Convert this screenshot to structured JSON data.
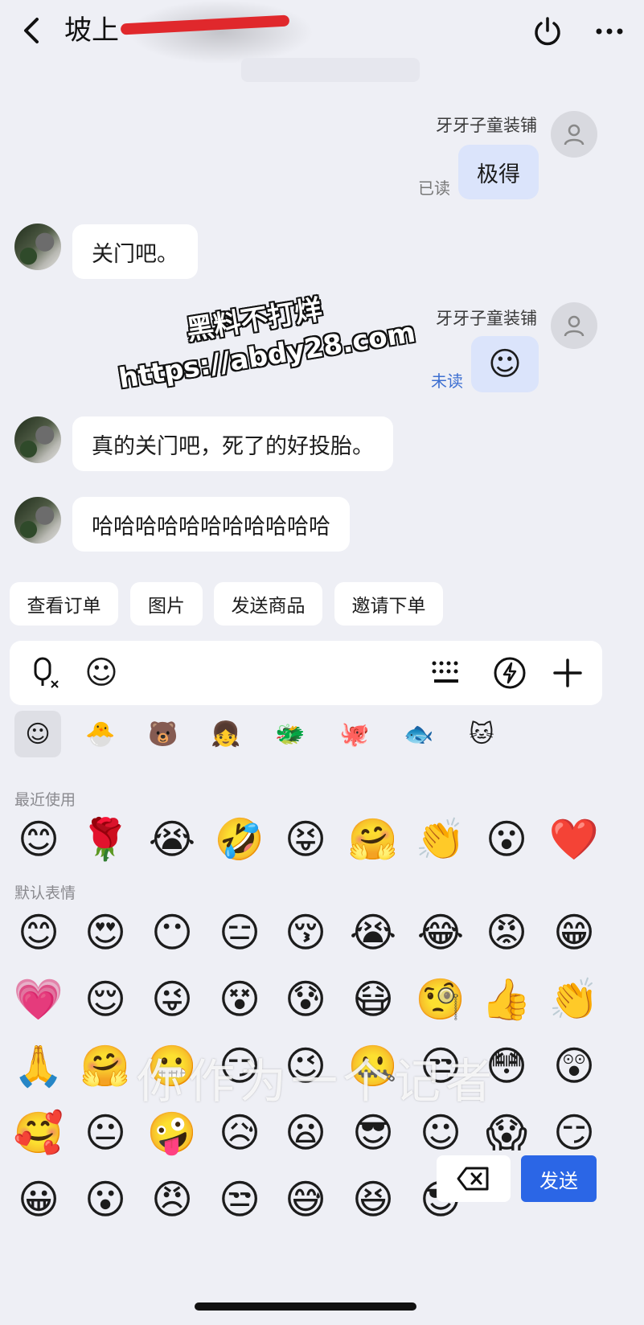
{
  "header": {
    "title": "坡上",
    "back_icon": "chevron-left-icon",
    "power_icon": "power-icon",
    "more_icon": "more-horizontal-icon"
  },
  "messages": [
    {
      "side": "right",
      "sender": "牙牙子童装铺",
      "text": "极得",
      "status": "已读"
    },
    {
      "side": "left",
      "text": "关门吧。"
    },
    {
      "side": "right",
      "sender": "牙牙子童装铺",
      "emoji": "☺",
      "status": "未读"
    },
    {
      "side": "left",
      "text": "真的关门吧，死了的好投胎。"
    },
    {
      "side": "left",
      "text": "哈哈哈哈哈哈哈哈哈哈哈"
    }
  ],
  "watermark": {
    "line1": "黑料不打烊",
    "line2": "https://abdy28.com",
    "subtitle": "你作为一个记者"
  },
  "quick_replies": [
    "查看订单",
    "图片",
    "发送商品",
    "邀请下单"
  ],
  "input_bar": {
    "voice_icon": "microphone-icon",
    "emoji_icon": "emoji-icon",
    "keyboard_icon": "keyboard-icon",
    "quick_icon": "lightning-icon",
    "plus_icon": "plus-icon"
  },
  "emoji_categories": [
    "☺",
    "🐣",
    "🐻",
    "👧",
    "🐲",
    "🐙",
    "🐟",
    "🐱"
  ],
  "sections": {
    "recent": "最近使用",
    "default": "默认表情"
  },
  "recent_emojis": [
    "😊",
    "🌹",
    "😭",
    "🤣",
    "😝",
    "🤗",
    "👏",
    "😮",
    "❤️"
  ],
  "default_emojis": [
    "😊",
    "😍",
    "😶",
    "😑",
    "😚",
    "😭",
    "😂",
    "😡",
    "😁",
    "💗",
    "😌",
    "😜",
    "😵",
    "😰",
    "😷",
    "🧐",
    "👍",
    "👏",
    "🙏",
    "🤗",
    "😬",
    "😏",
    "😉",
    "🤐",
    "😒",
    "😳",
    "😲",
    "🥰",
    "😐",
    "🤪",
    "😥",
    "😦",
    "😎",
    "☺",
    "😱",
    "😏",
    "😀",
    "😮",
    "😠",
    "😒",
    "😅",
    "😆",
    "😎"
  ],
  "actions": {
    "delete_icon": "backspace-icon",
    "send_label": "发送"
  }
}
